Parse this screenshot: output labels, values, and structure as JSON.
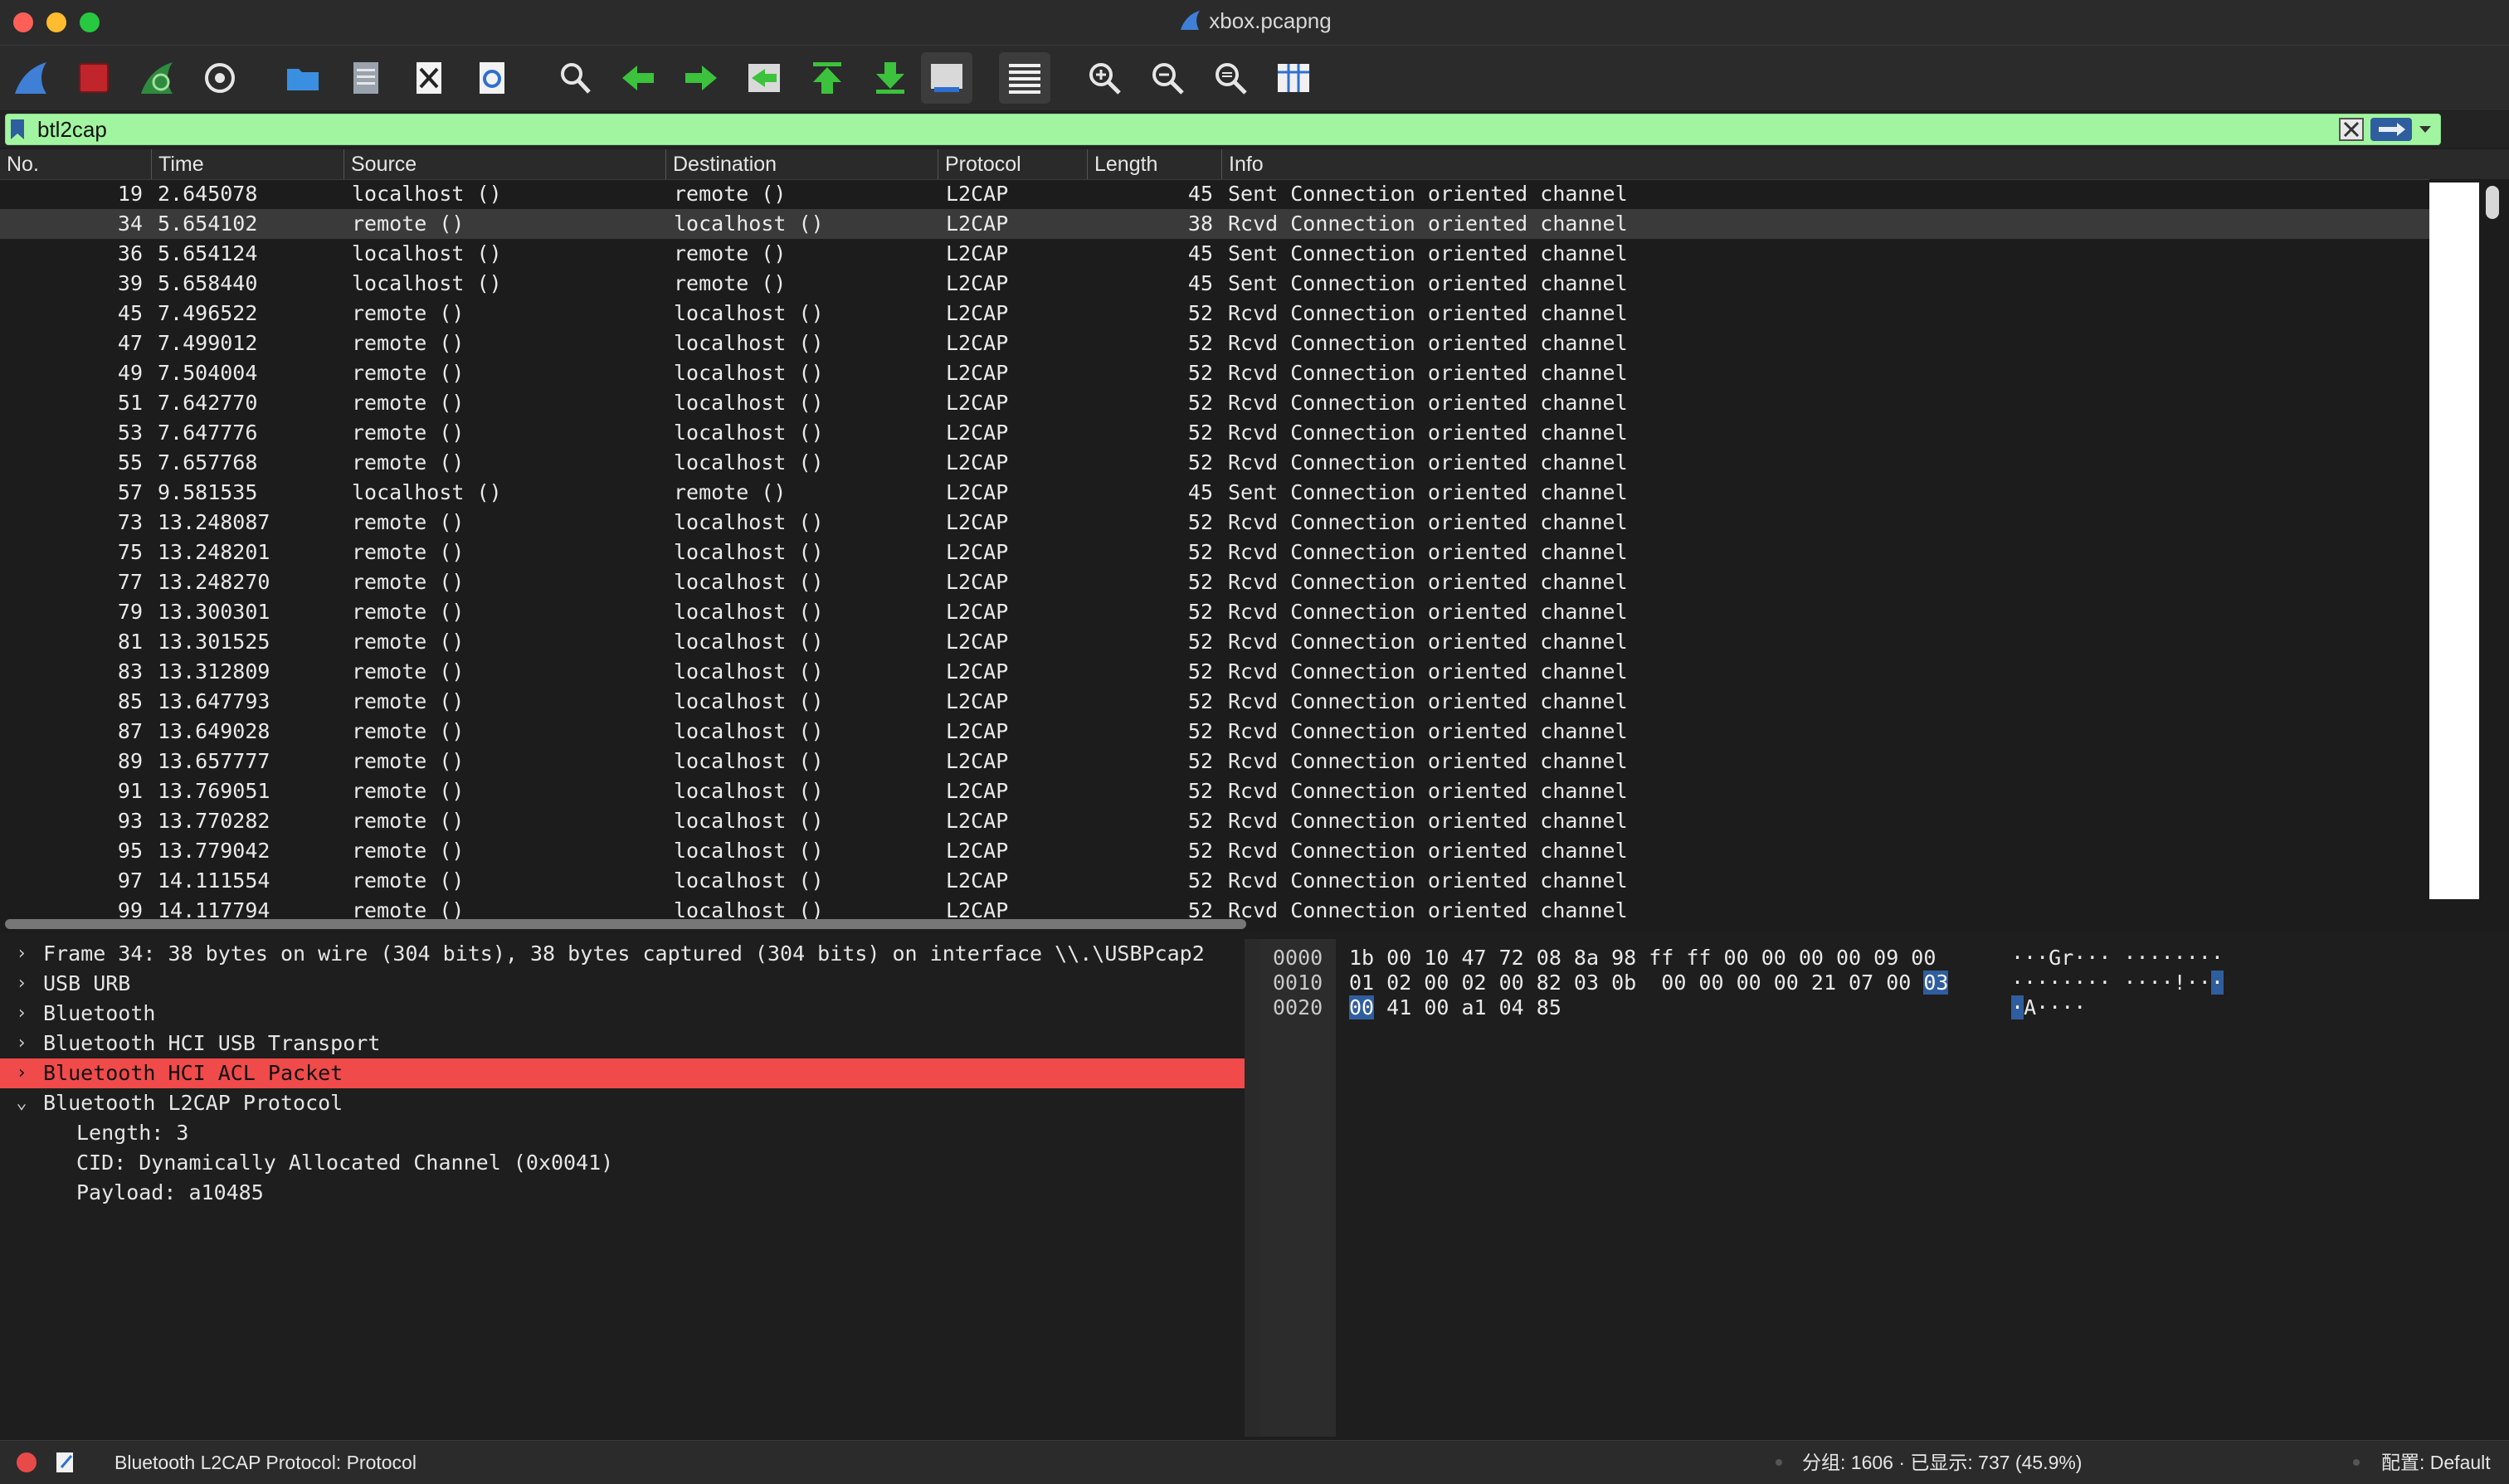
{
  "window": {
    "title": "xbox.pcapng"
  },
  "filter": {
    "value": "btl2cap"
  },
  "packet_list": {
    "columns": [
      "No.",
      "Time",
      "Source",
      "Destination",
      "Protocol",
      "Length",
      "Info"
    ],
    "rows": [
      {
        "no": "19",
        "time": "2.645078",
        "src": "localhost ()",
        "dst": "remote ()",
        "proto": "L2CAP",
        "len": "45",
        "info": "Sent Connection oriented channel"
      },
      {
        "no": "34",
        "time": "5.654102",
        "src": "remote ()",
        "dst": "localhost ()",
        "proto": "L2CAP",
        "len": "38",
        "info": "Rcvd Connection oriented channel"
      },
      {
        "no": "36",
        "time": "5.654124",
        "src": "localhost ()",
        "dst": "remote ()",
        "proto": "L2CAP",
        "len": "45",
        "info": "Sent Connection oriented channel"
      },
      {
        "no": "39",
        "time": "5.658440",
        "src": "localhost ()",
        "dst": "remote ()",
        "proto": "L2CAP",
        "len": "45",
        "info": "Sent Connection oriented channel"
      },
      {
        "no": "45",
        "time": "7.496522",
        "src": "remote ()",
        "dst": "localhost ()",
        "proto": "L2CAP",
        "len": "52",
        "info": "Rcvd Connection oriented channel"
      },
      {
        "no": "47",
        "time": "7.499012",
        "src": "remote ()",
        "dst": "localhost ()",
        "proto": "L2CAP",
        "len": "52",
        "info": "Rcvd Connection oriented channel"
      },
      {
        "no": "49",
        "time": "7.504004",
        "src": "remote ()",
        "dst": "localhost ()",
        "proto": "L2CAP",
        "len": "52",
        "info": "Rcvd Connection oriented channel"
      },
      {
        "no": "51",
        "time": "7.642770",
        "src": "remote ()",
        "dst": "localhost ()",
        "proto": "L2CAP",
        "len": "52",
        "info": "Rcvd Connection oriented channel"
      },
      {
        "no": "53",
        "time": "7.647776",
        "src": "remote ()",
        "dst": "localhost ()",
        "proto": "L2CAP",
        "len": "52",
        "info": "Rcvd Connection oriented channel"
      },
      {
        "no": "55",
        "time": "7.657768",
        "src": "remote ()",
        "dst": "localhost ()",
        "proto": "L2CAP",
        "len": "52",
        "info": "Rcvd Connection oriented channel"
      },
      {
        "no": "57",
        "time": "9.581535",
        "src": "localhost ()",
        "dst": "remote ()",
        "proto": "L2CAP",
        "len": "45",
        "info": "Sent Connection oriented channel"
      },
      {
        "no": "73",
        "time": "13.248087",
        "src": "remote ()",
        "dst": "localhost ()",
        "proto": "L2CAP",
        "len": "52",
        "info": "Rcvd Connection oriented channel"
      },
      {
        "no": "75",
        "time": "13.248201",
        "src": "remote ()",
        "dst": "localhost ()",
        "proto": "L2CAP",
        "len": "52",
        "info": "Rcvd Connection oriented channel"
      },
      {
        "no": "77",
        "time": "13.248270",
        "src": "remote ()",
        "dst": "localhost ()",
        "proto": "L2CAP",
        "len": "52",
        "info": "Rcvd Connection oriented channel"
      },
      {
        "no": "79",
        "time": "13.300301",
        "src": "remote ()",
        "dst": "localhost ()",
        "proto": "L2CAP",
        "len": "52",
        "info": "Rcvd Connection oriented channel"
      },
      {
        "no": "81",
        "time": "13.301525",
        "src": "remote ()",
        "dst": "localhost ()",
        "proto": "L2CAP",
        "len": "52",
        "info": "Rcvd Connection oriented channel"
      },
      {
        "no": "83",
        "time": "13.312809",
        "src": "remote ()",
        "dst": "localhost ()",
        "proto": "L2CAP",
        "len": "52",
        "info": "Rcvd Connection oriented channel"
      },
      {
        "no": "85",
        "time": "13.647793",
        "src": "remote ()",
        "dst": "localhost ()",
        "proto": "L2CAP",
        "len": "52",
        "info": "Rcvd Connection oriented channel"
      },
      {
        "no": "87",
        "time": "13.649028",
        "src": "remote ()",
        "dst": "localhost ()",
        "proto": "L2CAP",
        "len": "52",
        "info": "Rcvd Connection oriented channel"
      },
      {
        "no": "89",
        "time": "13.657777",
        "src": "remote ()",
        "dst": "localhost ()",
        "proto": "L2CAP",
        "len": "52",
        "info": "Rcvd Connection oriented channel"
      },
      {
        "no": "91",
        "time": "13.769051",
        "src": "remote ()",
        "dst": "localhost ()",
        "proto": "L2CAP",
        "len": "52",
        "info": "Rcvd Connection oriented channel"
      },
      {
        "no": "93",
        "time": "13.770282",
        "src": "remote ()",
        "dst": "localhost ()",
        "proto": "L2CAP",
        "len": "52",
        "info": "Rcvd Connection oriented channel"
      },
      {
        "no": "95",
        "time": "13.779042",
        "src": "remote ()",
        "dst": "localhost ()",
        "proto": "L2CAP",
        "len": "52",
        "info": "Rcvd Connection oriented channel"
      },
      {
        "no": "97",
        "time": "14.111554",
        "src": "remote ()",
        "dst": "localhost ()",
        "proto": "L2CAP",
        "len": "52",
        "info": "Rcvd Connection oriented channel"
      },
      {
        "no": "99",
        "time": "14.117794",
        "src": "remote ()",
        "dst": "localhost ()",
        "proto": "L2CAP",
        "len": "52",
        "info": "Rcvd Connection oriented channel"
      }
    ]
  },
  "details": {
    "frame": "Frame 34: 38 bytes on wire (304 bits), 38 bytes captured (304 bits) on interface \\\\.\\USBPcap2",
    "usb_urb": "USB URB",
    "bluetooth": "Bluetooth",
    "hci_usb": "Bluetooth HCI USB Transport",
    "hci_acl": "Bluetooth HCI ACL Packet",
    "l2cap": "Bluetooth L2CAP Protocol",
    "length": "Length: 3",
    "cid": "CID: Dynamically Allocated Channel (0x0041)",
    "payload": "Payload: a10485"
  },
  "bytes": {
    "r0": {
      "offset": "0000",
      "hex": "1b 00 10 47 72 08 8a 98  ff ff 00 00 00 00 09 00",
      "ascii": "···Gr··· ········"
    },
    "r1": {
      "offset": "0010",
      "hex_a": "01 02 00 02 00 82 03 0b  00 00 00 00 21 07 00 ",
      "hex_sel": "03",
      "ascii_a": "········ ····!··",
      "ascii_sel": "·"
    },
    "r2": {
      "offset": "0020",
      "hex_sel": "00",
      "hex_b": " 41 00 a1 04 85",
      "ascii_sel": "·",
      "ascii_b": "A····"
    }
  },
  "status": {
    "text": "Bluetooth L2CAP Protocol: Protocol",
    "packets": "分组: 1606 · 已显示: 737 (45.9%)",
    "profile": "配置: Default"
  }
}
